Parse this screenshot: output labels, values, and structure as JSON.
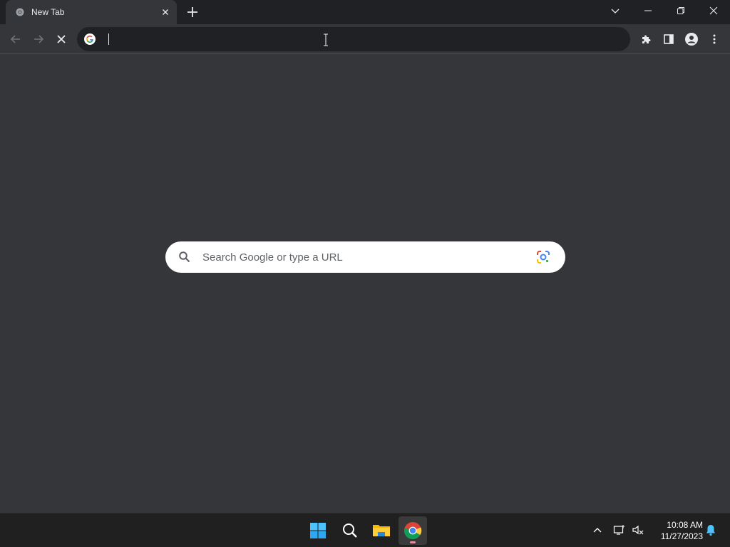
{
  "browser": {
    "tab": {
      "title": "New Tab"
    },
    "omnibox": {
      "value": ""
    }
  },
  "newtab": {
    "search": {
      "placeholder": "Search Google or type a URL"
    }
  },
  "taskbar": {
    "items": [
      "start-icon",
      "search-icon",
      "file-explorer-icon",
      "chrome-icon"
    ],
    "clock": {
      "time": "10:08 AM",
      "date": "11/27/2023"
    }
  },
  "colors": {
    "tabstrip": "#202124",
    "toolbar": "#35363a",
    "omnibox": "#202124",
    "content": "#35363a",
    "taskbar": "#202020"
  }
}
